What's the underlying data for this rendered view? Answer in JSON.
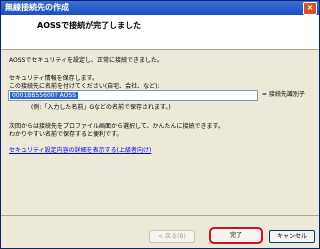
{
  "window": {
    "title": "無線接続先の作成"
  },
  "header": {
    "heading": "AOSSで接続が完了しました"
  },
  "body": {
    "line1": "AOSSでセキュリティを設定し、正常に接続できました。",
    "line2": "セキュリティ情報を保存します。",
    "line3": "この接続先に名前を付けてください(自宅、会社、など):",
    "input_value": "0001BB55600? AOSS",
    "input_hint": "= 接続先識別子",
    "example": "(例:「入力した名前」Gなどの名前で保存されます。)",
    "line4": "次回からは接続先をプロファイル画面から選択して、かんたんに接続できます。",
    "line5": "わかりやすい名前で保存すると便利です。",
    "details_link": "セキュリティ設定内容の詳細を表示する(上級者向け)"
  },
  "buttons": {
    "back": "< 戻る(B)",
    "finish": "完了",
    "cancel": "キャンセル"
  }
}
